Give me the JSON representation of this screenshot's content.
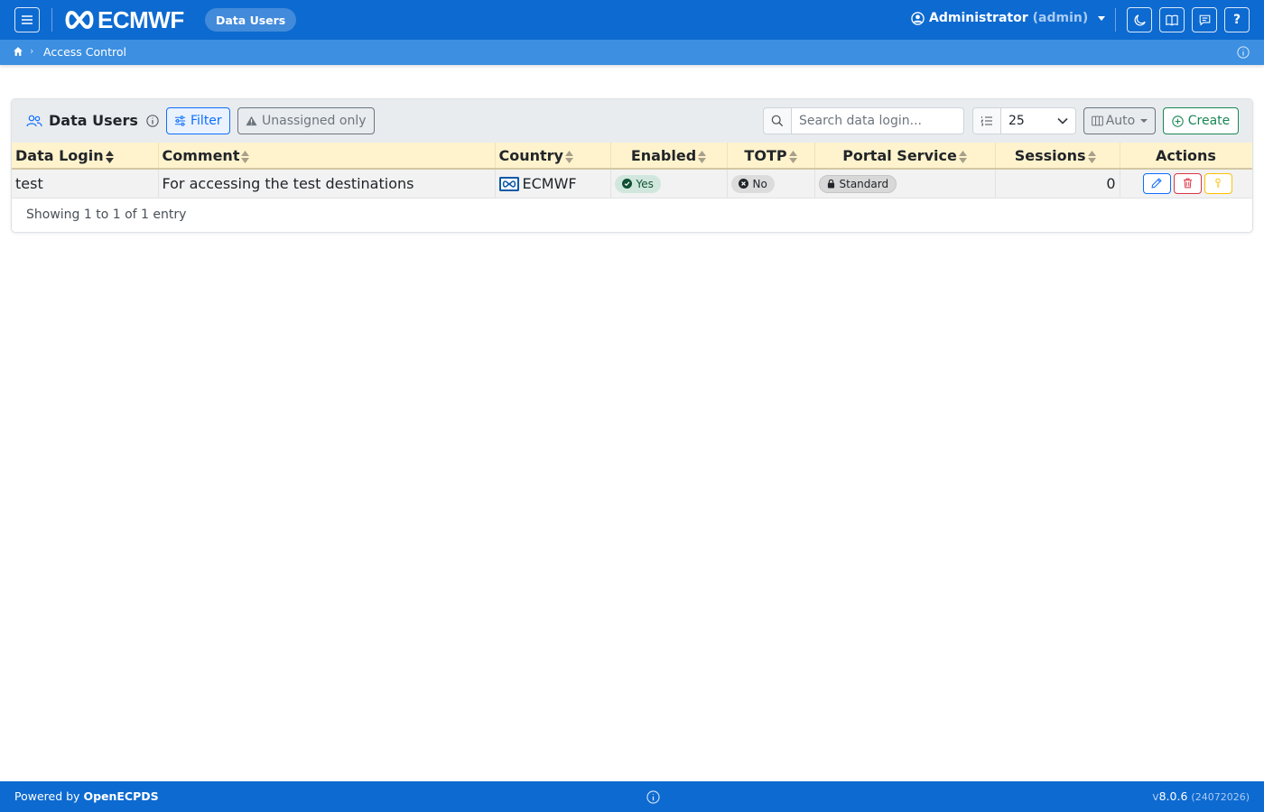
{
  "navbar": {
    "brand": "ECMWF",
    "app_badge": "Data Users",
    "user_name": "Administrator",
    "user_login": "(admin)",
    "colors": {
      "primary": "#0d6ad0",
      "breadcrumb": "#3c8fe1"
    }
  },
  "breadcrumb": {
    "current": "Access Control"
  },
  "card": {
    "title": "Data Users",
    "filter_label": "Filter",
    "unassigned_label": "Unassigned only",
    "search_placeholder": "Search data login...",
    "page_length": "25",
    "columns_label": "Auto",
    "create_label": "Create"
  },
  "table": {
    "columns": {
      "login": "Data Login",
      "comment": "Comment",
      "country": "Country",
      "enabled": "Enabled",
      "totp": "TOTP",
      "portal": "Portal Service",
      "sessions": "Sessions",
      "actions": "Actions"
    },
    "rows": [
      {
        "login": "test",
        "comment": "For accessing the test destinations",
        "country": "ECMWF",
        "enabled": "Yes",
        "totp": "No",
        "portal": "Standard",
        "sessions": "0"
      }
    ],
    "info": "Showing 1 to 1 of 1 entry"
  },
  "footer": {
    "powered_prefix": "Powered by",
    "powered_name": "OpenECPDS",
    "version_prefix": "v",
    "version": "8.0.6",
    "build": "(24072026)"
  }
}
